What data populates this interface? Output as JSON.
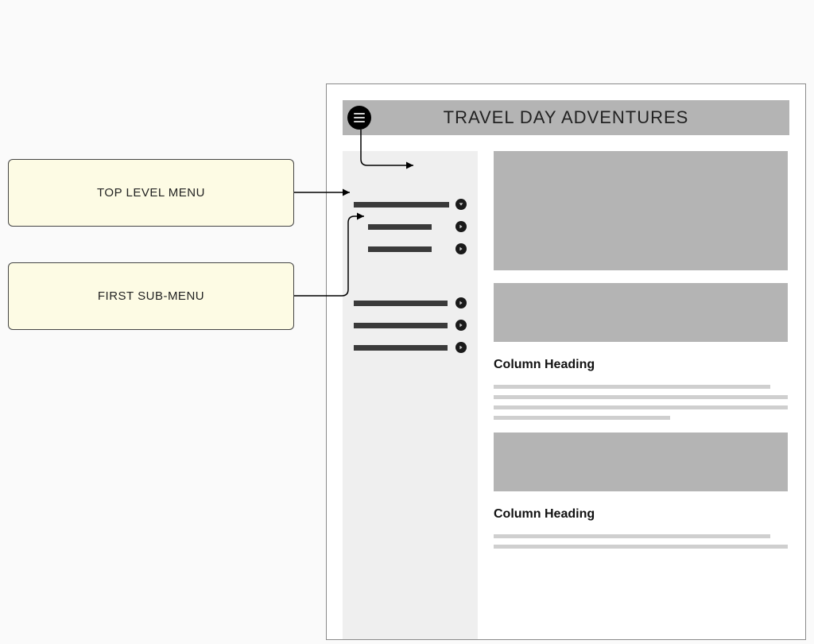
{
  "callouts": {
    "top_level": "TOP LEVEL MENU",
    "first_sub": "FIRST SUB-MENU"
  },
  "header": {
    "title": "TRAVEL DAY ADVENTURES"
  },
  "content": {
    "heading1": "Column Heading",
    "heading2": "Column Heading"
  }
}
